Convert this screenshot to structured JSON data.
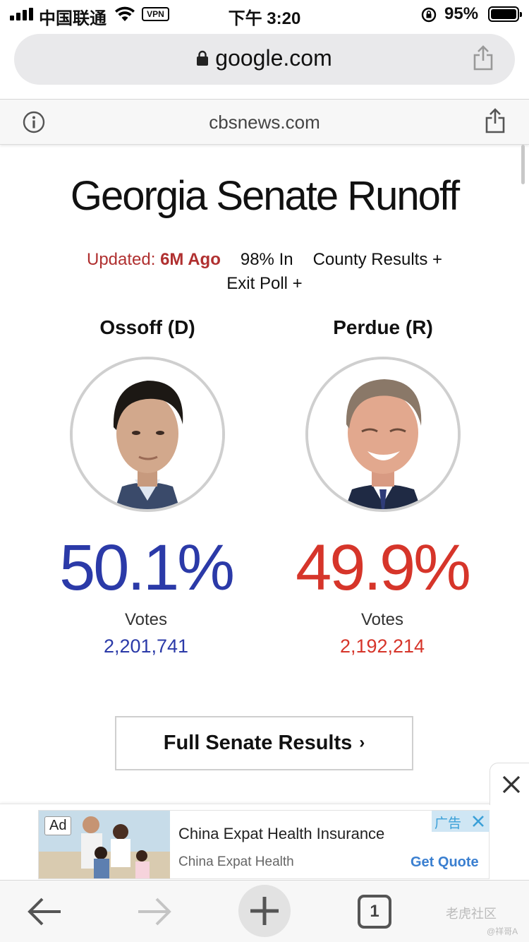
{
  "status_bar": {
    "carrier": "中国联通",
    "vpn": "VPN",
    "time": "下午 3:20",
    "battery_percent": "95%"
  },
  "url_bar": {
    "domain": "google.com"
  },
  "amp_bar": {
    "domain": "cbsnews.com"
  },
  "page": {
    "title": "Georgia Senate Runoff",
    "updated_label": "Updated:",
    "updated_value": "6M Ago",
    "reporting": "98% In",
    "county_link": "County Results +",
    "exit_poll_link": "Exit Poll +"
  },
  "candidates": [
    {
      "name": "Ossoff (D)",
      "percent": "50.1%",
      "votes_label": "Votes",
      "votes": "2,201,741",
      "color": "#2b3aa8"
    },
    {
      "name": "Perdue (R)",
      "percent": "49.9%",
      "votes_label": "Votes",
      "votes": "2,192,214",
      "color": "#d6352a"
    }
  ],
  "full_results_button": {
    "label": "Full Senate Results",
    "chevron": "›"
  },
  "ad": {
    "badge": "Ad",
    "title": "China Expat Health Insurance",
    "advertiser": "China Expat Health",
    "cta": "Get Quote",
    "ad_choice_text": "广告",
    "close_icon": "close-icon"
  },
  "toolbar": {
    "tab_count": "1",
    "watermark": "老虎社区",
    "watermark_user": "@祥哥A"
  }
}
